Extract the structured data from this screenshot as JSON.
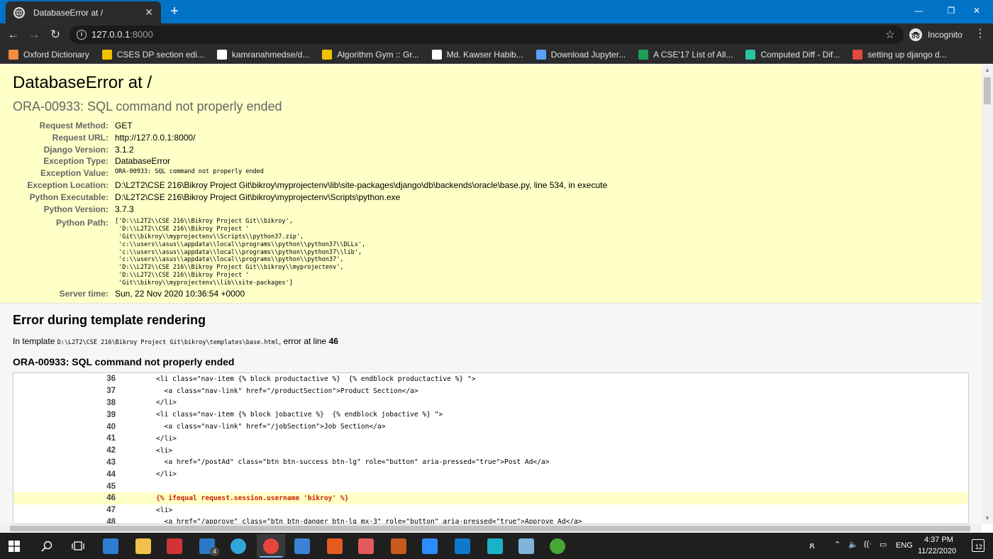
{
  "browser": {
    "tab_title": "DatabaseError at /",
    "new_tab": "+",
    "url_host": "127.0.0.1",
    "url_port": ":8000",
    "profile_label": "Incognito",
    "bookmarks": [
      {
        "label": "Oxford Dictionary",
        "icon": "oxford-icon",
        "color": "#f28b3b"
      },
      {
        "label": "CSES DP section edi...",
        "icon": "bar-chart-icon",
        "color": "#f2c200"
      },
      {
        "label": "kamranahmedse/d...",
        "icon": "github-icon",
        "color": "#ffffff"
      },
      {
        "label": "Algorithm Gym :: Gr...",
        "icon": "bar-chart-icon",
        "color": "#f2c200"
      },
      {
        "label": "Md. Kawser Habib...",
        "icon": "medium-icon",
        "color": "#ffffff"
      },
      {
        "label": "Download Jupyter...",
        "icon": "infinity-icon",
        "color": "#5aa0ff"
      },
      {
        "label": "A CSE'17 List of All...",
        "icon": "sheets-icon",
        "color": "#1e9e55"
      },
      {
        "label": "Computed Diff - Dif...",
        "icon": "diff-icon",
        "color": "#2cc1a0"
      },
      {
        "label": "setting up django d...",
        "icon": "code-icon",
        "color": "#e04a3a"
      }
    ]
  },
  "error": {
    "title": "DatabaseError at /",
    "subtitle": "ORA-00933: SQL command not properly ended",
    "meta": [
      {
        "key": "Request Method:",
        "value": "GET",
        "mono": false
      },
      {
        "key": "Request URL:",
        "value": "http://127.0.0.1:8000/",
        "mono": false
      },
      {
        "key": "Django Version:",
        "value": "3.1.2",
        "mono": false
      },
      {
        "key": "Exception Type:",
        "value": "DatabaseError",
        "mono": false
      },
      {
        "key": "Exception Value:",
        "value": "ORA-00933: SQL command not properly ended",
        "mono": true
      },
      {
        "key": "Exception Location:",
        "value": "D:\\L2T2\\CSE 216\\Bikroy Project Git\\bikroy\\myprojectenv\\lib\\site-packages\\django\\db\\backends\\oracle\\base.py, line 534, in execute",
        "mono": false
      },
      {
        "key": "Python Executable:",
        "value": "D:\\L2T2\\CSE 216\\Bikroy Project Git\\bikroy\\myprojectenv\\Scripts\\python.exe",
        "mono": false
      },
      {
        "key": "Python Version:",
        "value": "3.7.3",
        "mono": false
      }
    ],
    "python_path_key": "Python Path:",
    "python_path": [
      "['D:\\\\L2T2\\\\CSE 216\\\\Bikroy Project Git\\\\bikroy',",
      " 'D:\\\\L2T2\\\\CSE 216\\\\Bikroy Project '",
      " 'Git\\\\bikroy\\\\myprojectenv\\\\Scripts\\\\python37.zip',",
      " 'c:\\\\users\\\\asus\\\\appdata\\\\local\\\\programs\\\\python\\\\python37\\\\DLLs',",
      " 'c:\\\\users\\\\asus\\\\appdata\\\\local\\\\programs\\\\python\\\\python37\\\\lib',",
      " 'c:\\\\users\\\\asus\\\\appdata\\\\local\\\\programs\\\\python\\\\python37',",
      " 'D:\\\\L2T2\\\\CSE 216\\\\Bikroy Project Git\\\\bikroy\\\\myprojectenv',",
      " 'D:\\\\L2T2\\\\CSE 216\\\\Bikroy Project '",
      " 'Git\\\\bikroy\\\\myprojectenv\\\\lib\\\\site-packages']"
    ],
    "server_time_key": "Server time:",
    "server_time": "Sun, 22 Nov 2020 10:36:54 +0000"
  },
  "template": {
    "heading": "Error during template rendering",
    "info_prefix": "In template ",
    "info_path": "D:\\L2T2\\CSE 216\\Bikroy Project Git\\bikroy\\templates\\base.html",
    "info_mid": ", error at line ",
    "info_line": "46",
    "subheading": "ORA-00933: SQL command not properly ended",
    "source": [
      {
        "line": "36",
        "code": "<li class=\"nav-item {% block productactive %}  {% endblock productactive %} \">",
        "hl": false
      },
      {
        "line": "37",
        "code": "  <a class=\"nav-link\" href=\"/productSection\">Product Section</a>",
        "hl": false
      },
      {
        "line": "38",
        "code": "</li>",
        "hl": false
      },
      {
        "line": "39",
        "code": "<li class=\"nav-item {% block jobactive %}  {% endblock jobactive %} \">",
        "hl": false
      },
      {
        "line": "40",
        "code": "  <a class=\"nav-link\" href=\"/jobSection\">Job Section</a>",
        "hl": false
      },
      {
        "line": "41",
        "code": "</li>",
        "hl": false
      },
      {
        "line": "42",
        "code": "<li>",
        "hl": false
      },
      {
        "line": "43",
        "code": "  <a href=\"/postAd\" class=\"btn btn-success btn-lg\" role=\"button\" aria-pressed=\"true\">Post Ad</a>",
        "hl": false
      },
      {
        "line": "44",
        "code": "</li>",
        "hl": false
      },
      {
        "line": "45",
        "code": "",
        "hl": false
      },
      {
        "line": "46",
        "code": "{% ifequal request.session.username 'bikroy' %}",
        "hl": true
      },
      {
        "line": "47",
        "code": "<li>",
        "hl": false
      },
      {
        "line": "48",
        "code": "  <a href=\"/approve\" class=\"btn btn-danger btn-lg mx-3\" role=\"button\" aria-pressed=\"true\">Approve Ad</a>",
        "hl": false
      }
    ]
  },
  "taskbar": {
    "mail_badge": "4",
    "lang": "ENG",
    "time": "4:37 PM",
    "date": "11/22/2020",
    "notif_count": "12",
    "apps": [
      {
        "name": "store-icon",
        "color": "#2d7dd2"
      },
      {
        "name": "file-explorer-icon",
        "color": "#f0c24b"
      },
      {
        "name": "gift-icon",
        "color": "#d13438"
      },
      {
        "name": "mail-icon",
        "color": "#2b78c8"
      },
      {
        "name": "edge-icon",
        "color": "#30a6d8"
      },
      {
        "name": "chrome-icon",
        "color": "#e8453c"
      },
      {
        "name": "app-icon",
        "color": "#3c82d6"
      },
      {
        "name": "office-icon",
        "color": "#e35b1e"
      },
      {
        "name": "paint-icon",
        "color": "#e25a5a"
      },
      {
        "name": "sql-icon",
        "color": "#c55a1c"
      },
      {
        "name": "zoom-icon",
        "color": "#2d8cff"
      },
      {
        "name": "vscode-icon",
        "color": "#0f7acc"
      },
      {
        "name": "snip-icon",
        "color": "#19b3c7"
      },
      {
        "name": "notepad-icon",
        "color": "#7fb4dc"
      },
      {
        "name": "anaconda-icon",
        "color": "#44a833"
      }
    ]
  }
}
